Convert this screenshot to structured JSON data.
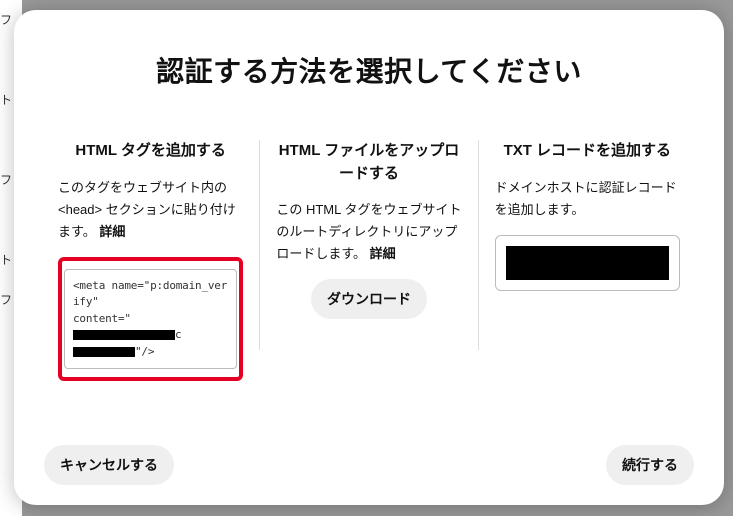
{
  "modal": {
    "title": "認証する方法を選択してください"
  },
  "common": {
    "detailsLabel": "詳細"
  },
  "options": {
    "htmlTag": {
      "heading": "HTML タグを追加する",
      "desc": "このタグをウェブサイト内の <head> セクションに貼り付けます。",
      "snippet": {
        "line1": "<meta name=\"p:domain_verify\"",
        "contentPrefix": "content=\"",
        "mid": "c",
        "tail": "\"/>"
      }
    },
    "htmlFile": {
      "heading": "HTML ファイルをアップロードする",
      "desc": "この HTML タグをウェブサイトのルートディレクトリにアップロードします。",
      "downloadLabel": "ダウンロード"
    },
    "txtRecord": {
      "heading": "TXT レコードを追加する",
      "desc": "ドメインホストに認証レコードを追加します。"
    }
  },
  "footer": {
    "cancel": "キャンセルする",
    "continue": "続行する"
  }
}
